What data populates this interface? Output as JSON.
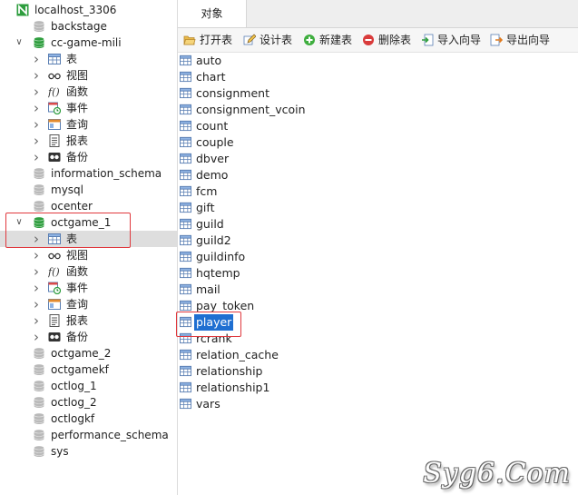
{
  "tree": {
    "connection": "localhost_3306",
    "databases_top": [
      "backstage"
    ],
    "db1": {
      "name": "cc-game-mili",
      "children": [
        "表",
        "视图",
        "函数",
        "事件",
        "查询",
        "报表",
        "备份"
      ]
    },
    "databases_mid": [
      "information_schema",
      "mysql",
      "ocenter"
    ],
    "db2": {
      "name": "octgame_1",
      "children": [
        "表",
        "视图",
        "函数",
        "事件",
        "查询",
        "报表",
        "备份"
      ]
    },
    "databases_bottom": [
      "octgame_2",
      "octgamekf",
      "octlog_1",
      "octlog_2",
      "octlogkf",
      "performance_schema",
      "sys"
    ]
  },
  "tabs": {
    "objects": "对象"
  },
  "toolbar": {
    "open_table": "打开表",
    "design_table": "设计表",
    "new_table": "新建表",
    "delete_table": "删除表",
    "import_wizard": "导入向导",
    "export_wizard": "导出向导"
  },
  "tables": [
    "auto",
    "chart",
    "consignment",
    "consignment_vcoin",
    "count",
    "couple",
    "dbver",
    "demo",
    "fcm",
    "gift",
    "guild",
    "guild2",
    "guildinfo",
    "hqtemp",
    "mail",
    "pay_token",
    "player",
    "rcrank",
    "relation_cache",
    "relationship",
    "relationship1",
    "vars"
  ],
  "selected_table": "player",
  "watermark": "Syg6.Com",
  "colors": {
    "accent": "#1f6fd1",
    "highlight_box": "#e0393e",
    "db_green": "#2e9e3e",
    "db_gray": "#b9b9b9"
  }
}
